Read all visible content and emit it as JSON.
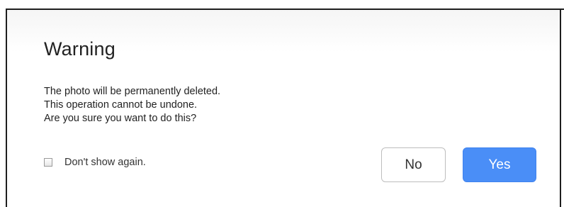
{
  "dialog": {
    "title": "Warning",
    "message_lines": [
      "The photo will be permanently deleted.",
      "This operation cannot be undone.",
      "Are you sure you want to do this?"
    ],
    "dont_show_again": {
      "label": "Don't show again.",
      "checked": false
    },
    "buttons": {
      "no_label": "No",
      "yes_label": "Yes"
    }
  },
  "colors": {
    "primary_button": "#4a8ef7",
    "frame_border": "#1e1e1e"
  }
}
